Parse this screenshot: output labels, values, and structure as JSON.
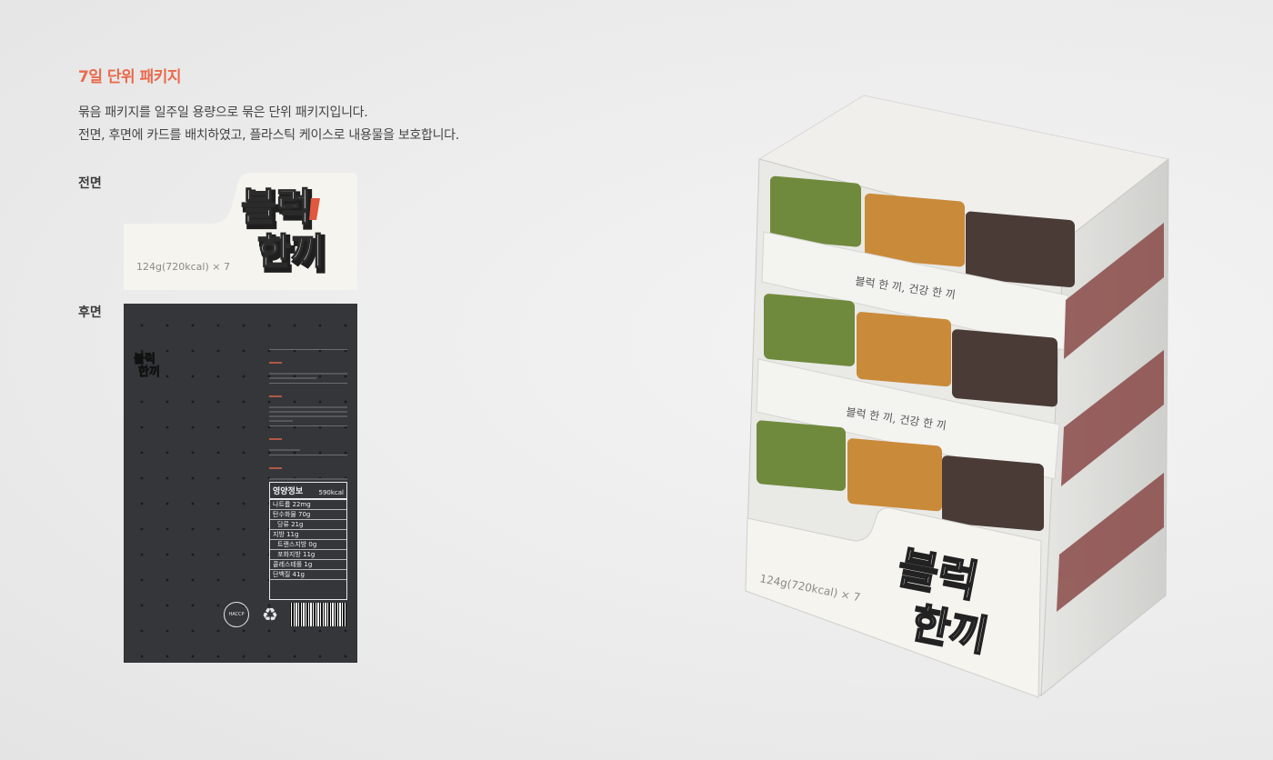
{
  "section": {
    "title": "7일 단위 패키지",
    "desc_lines": [
      "묶음 패키지를 일주일 용량으로 묶은 단위 패키지입니다.",
      "전면, 후면에 카드를 배치하였고, 플라스틱 케이스로 내용물을 보호합니다."
    ]
  },
  "front": {
    "label": "전면",
    "brand_line1": "블럭",
    "brand_line2": "한끼",
    "weight": "124g(720kcal) × 7"
  },
  "back": {
    "label": "후면",
    "nutrition": {
      "title": "영양정보",
      "total": "590kcal",
      "rows": [
        "나트륨 22mg",
        "탄수화물 70g",
        "당류 21g",
        "지방 11g",
        "트랜스지방 0g",
        "포화지방 11g",
        "콜레스테롤 1g",
        "단백질 41g"
      ]
    },
    "haccp": "HACCP"
  },
  "product": {
    "slogan": "블럭 한 끼, 건강 한 끼",
    "weight": "124g(720kcal) × 7"
  },
  "colors": {
    "accent": "#ea6a4c",
    "card_dark": "#34363a",
    "green": "#6f8a3c",
    "orange": "#c98a3a",
    "brown": "#4a3b36"
  }
}
